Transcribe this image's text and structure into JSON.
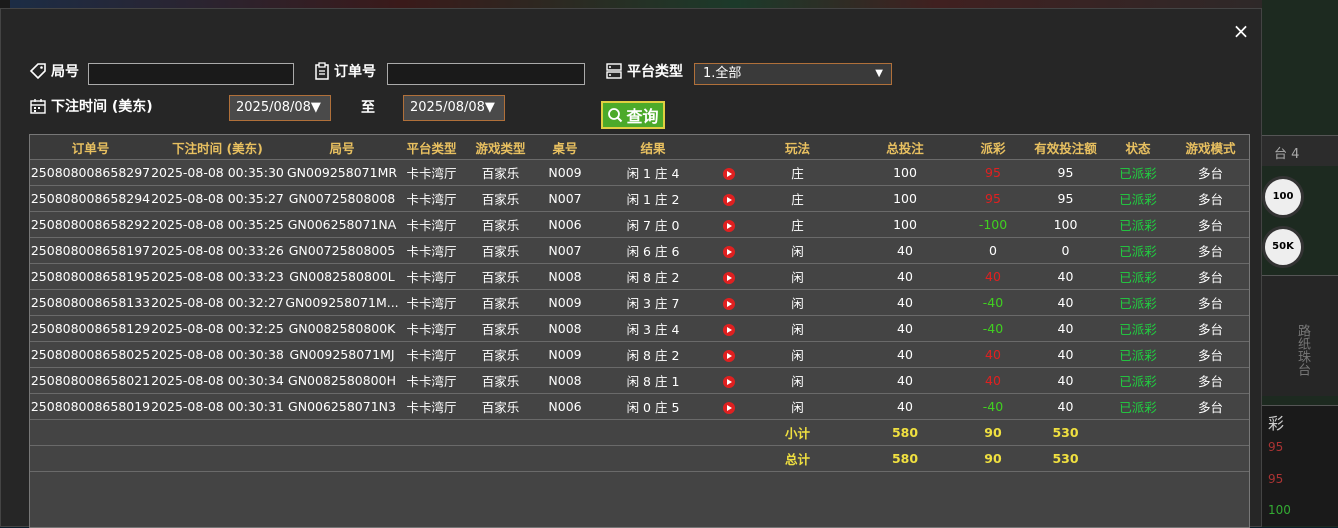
{
  "modal": {
    "close_label": "×"
  },
  "filters": {
    "round_label": "局号",
    "order_label": "订单号",
    "platform_label": "平台类型",
    "platform_value": "1.全部",
    "time_label": "下注时间 (美东)",
    "date_from": "2025/08/08▼",
    "to_label": "至",
    "date_to": "2025/08/08▼",
    "search_label": "查询"
  },
  "table": {
    "headers": [
      "订单号",
      "下注时间 (美东)",
      "局号",
      "平台类型",
      "游戏类型",
      "桌号",
      "结果",
      "",
      "玩法",
      "总投注",
      "派彩",
      "有效投注额",
      "状态",
      "游戏模式"
    ],
    "rows": [
      {
        "order": "250808008658297",
        "time": "2025-08-08 00:35:30",
        "round": "GN009258071MR",
        "platform": "卡卡湾厅",
        "game": "百家乐",
        "table": "N009",
        "result": "闲 1 庄 4",
        "play": "庄",
        "bet": "100",
        "payout": "95",
        "payout_type": "neg",
        "valid": "95",
        "status": "已派彩",
        "mode": "多台"
      },
      {
        "order": "250808008658294",
        "time": "2025-08-08 00:35:27",
        "round": "GN00725808008",
        "platform": "卡卡湾厅",
        "game": "百家乐",
        "table": "N007",
        "result": "闲 1 庄 2",
        "play": "庄",
        "bet": "100",
        "payout": "95",
        "payout_type": "neg",
        "valid": "95",
        "status": "已派彩",
        "mode": "多台"
      },
      {
        "order": "250808008658292",
        "time": "2025-08-08 00:35:25",
        "round": "GN006258071NA",
        "platform": "卡卡湾厅",
        "game": "百家乐",
        "table": "N006",
        "result": "闲 7 庄 0",
        "play": "庄",
        "bet": "100",
        "payout": "-100",
        "payout_type": "pos",
        "valid": "100",
        "status": "已派彩",
        "mode": "多台"
      },
      {
        "order": "250808008658197",
        "time": "2025-08-08 00:33:26",
        "round": "GN00725808005",
        "platform": "卡卡湾厅",
        "game": "百家乐",
        "table": "N007",
        "result": "闲 6 庄 6",
        "play": "闲",
        "bet": "40",
        "payout": "0",
        "payout_type": "plain",
        "valid": "0",
        "status": "已派彩",
        "mode": "多台"
      },
      {
        "order": "250808008658195",
        "time": "2025-08-08 00:33:23",
        "round": "GN0082580800L",
        "platform": "卡卡湾厅",
        "game": "百家乐",
        "table": "N008",
        "result": "闲 8 庄 2",
        "play": "闲",
        "bet": "40",
        "payout": "40",
        "payout_type": "neg",
        "valid": "40",
        "status": "已派彩",
        "mode": "多台"
      },
      {
        "order": "250808008658133",
        "time": "2025-08-08 00:32:27",
        "round": "GN009258071M...",
        "platform": "卡卡湾厅",
        "game": "百家乐",
        "table": "N009",
        "result": "闲 3 庄 7",
        "play": "闲",
        "bet": "40",
        "payout": "-40",
        "payout_type": "pos",
        "valid": "40",
        "status": "已派彩",
        "mode": "多台"
      },
      {
        "order": "250808008658129",
        "time": "2025-08-08 00:32:25",
        "round": "GN0082580800K",
        "platform": "卡卡湾厅",
        "game": "百家乐",
        "table": "N008",
        "result": "闲 3 庄 4",
        "play": "闲",
        "bet": "40",
        "payout": "-40",
        "payout_type": "pos",
        "valid": "40",
        "status": "已派彩",
        "mode": "多台"
      },
      {
        "order": "250808008658025",
        "time": "2025-08-08 00:30:38",
        "round": "GN009258071MJ",
        "platform": "卡卡湾厅",
        "game": "百家乐",
        "table": "N009",
        "result": "闲 8 庄 2",
        "play": "闲",
        "bet": "40",
        "payout": "40",
        "payout_type": "neg",
        "valid": "40",
        "status": "已派彩",
        "mode": "多台"
      },
      {
        "order": "250808008658021",
        "time": "2025-08-08 00:30:34",
        "round": "GN0082580800H",
        "platform": "卡卡湾厅",
        "game": "百家乐",
        "table": "N008",
        "result": "闲 8 庄 1",
        "play": "闲",
        "bet": "40",
        "payout": "40",
        "payout_type": "neg",
        "valid": "40",
        "status": "已派彩",
        "mode": "多台"
      },
      {
        "order": "250808008658019",
        "time": "2025-08-08 00:30:31",
        "round": "GN006258071N3",
        "platform": "卡卡湾厅",
        "game": "百家乐",
        "table": "N006",
        "result": "闲 0 庄 5",
        "play": "闲",
        "bet": "40",
        "payout": "-40",
        "payout_type": "pos",
        "valid": "40",
        "status": "已派彩",
        "mode": "多台"
      }
    ],
    "subtotal": {
      "label": "小计",
      "bet": "580",
      "payout": "90",
      "valid": "530"
    },
    "total": {
      "label": "总计",
      "bet": "580",
      "payout": "90",
      "valid": "530"
    }
  },
  "background": {
    "tab_label": "台 4",
    "chip_1": "100",
    "chip_2": "50K",
    "side_label": "路纸珠台",
    "heading": "彩",
    "val_1": "95",
    "val_2": "95",
    "val_3": "100"
  },
  "colors": {
    "header_text": "#e8c060",
    "payout_red": "#e02020",
    "payout_green": "#40d020",
    "status_green": "#20d040",
    "summary_yellow": "#f0e040",
    "search_bg": "#4caa2a"
  }
}
